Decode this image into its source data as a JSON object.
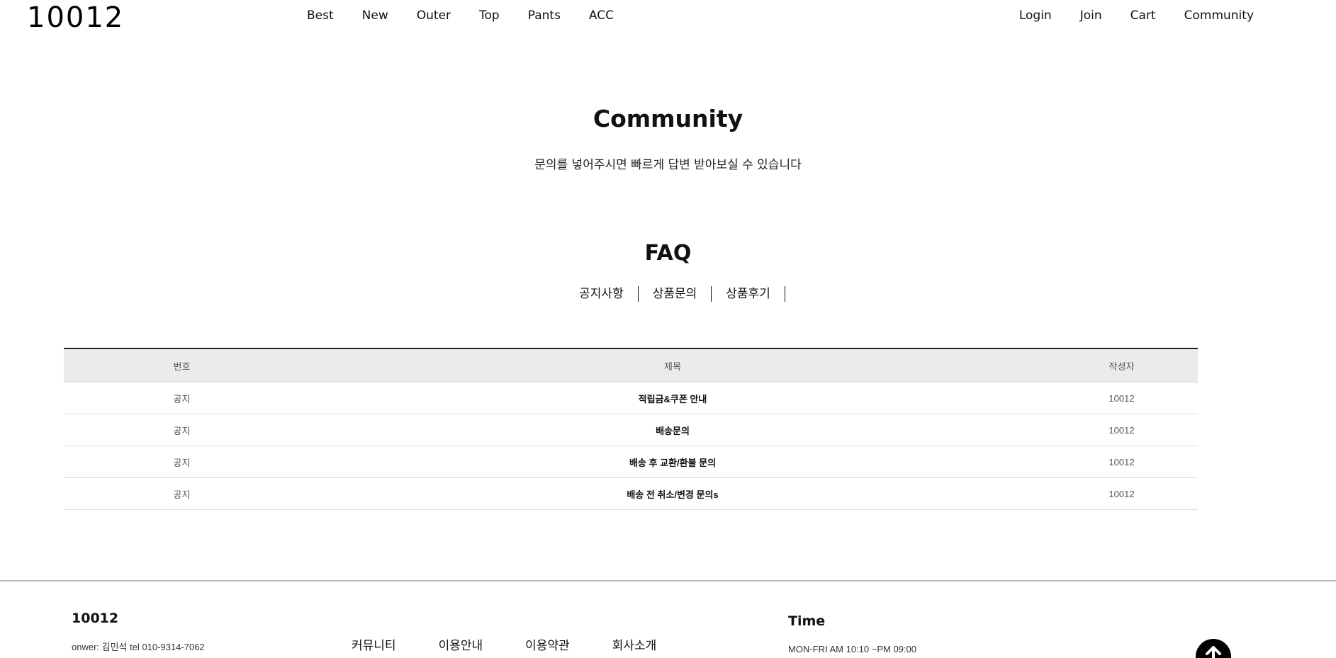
{
  "header": {
    "logo": "10012",
    "nav": [
      "Best",
      "New",
      "Outer",
      "Top",
      "Pants",
      "ACC"
    ],
    "user_nav": [
      "Login",
      "Join",
      "Cart",
      "Community"
    ]
  },
  "page": {
    "title": "Community",
    "subtitle": "문의를 넣어주시면 빠르게 답변 받아보실 수 있습니다"
  },
  "faq": {
    "title": "FAQ",
    "tabs": [
      "공지사항",
      "상품문의",
      "상품후기"
    ]
  },
  "board": {
    "headers": {
      "no": "번호",
      "title": "제목",
      "author": "작성자"
    },
    "rows": [
      {
        "no": "공지",
        "title": "적립금&쿠폰 안내",
        "author": "10012"
      },
      {
        "no": "공지",
        "title": "배송문의",
        "author": "10012"
      },
      {
        "no": "공지",
        "title": "배송 후 교환/환불 문의",
        "author": "10012"
      },
      {
        "no": "공지",
        "title": "배송 전 취소/변경 문의s",
        "author": "10012"
      }
    ]
  },
  "footer": {
    "brand": "10012",
    "owner": "onwer: 김민석 tel 010-9314-7062",
    "links": [
      "커뮤니티",
      "이용안내",
      "이용약관",
      "회사소개"
    ],
    "time_title": "Time",
    "time": "MON-FRI AM 10:10 ~PM 09:00"
  },
  "icons": {
    "top_button": "arrow-up-icon"
  },
  "colors": {
    "accent": "#000000",
    "table_header_bg": "#ebebeb"
  }
}
